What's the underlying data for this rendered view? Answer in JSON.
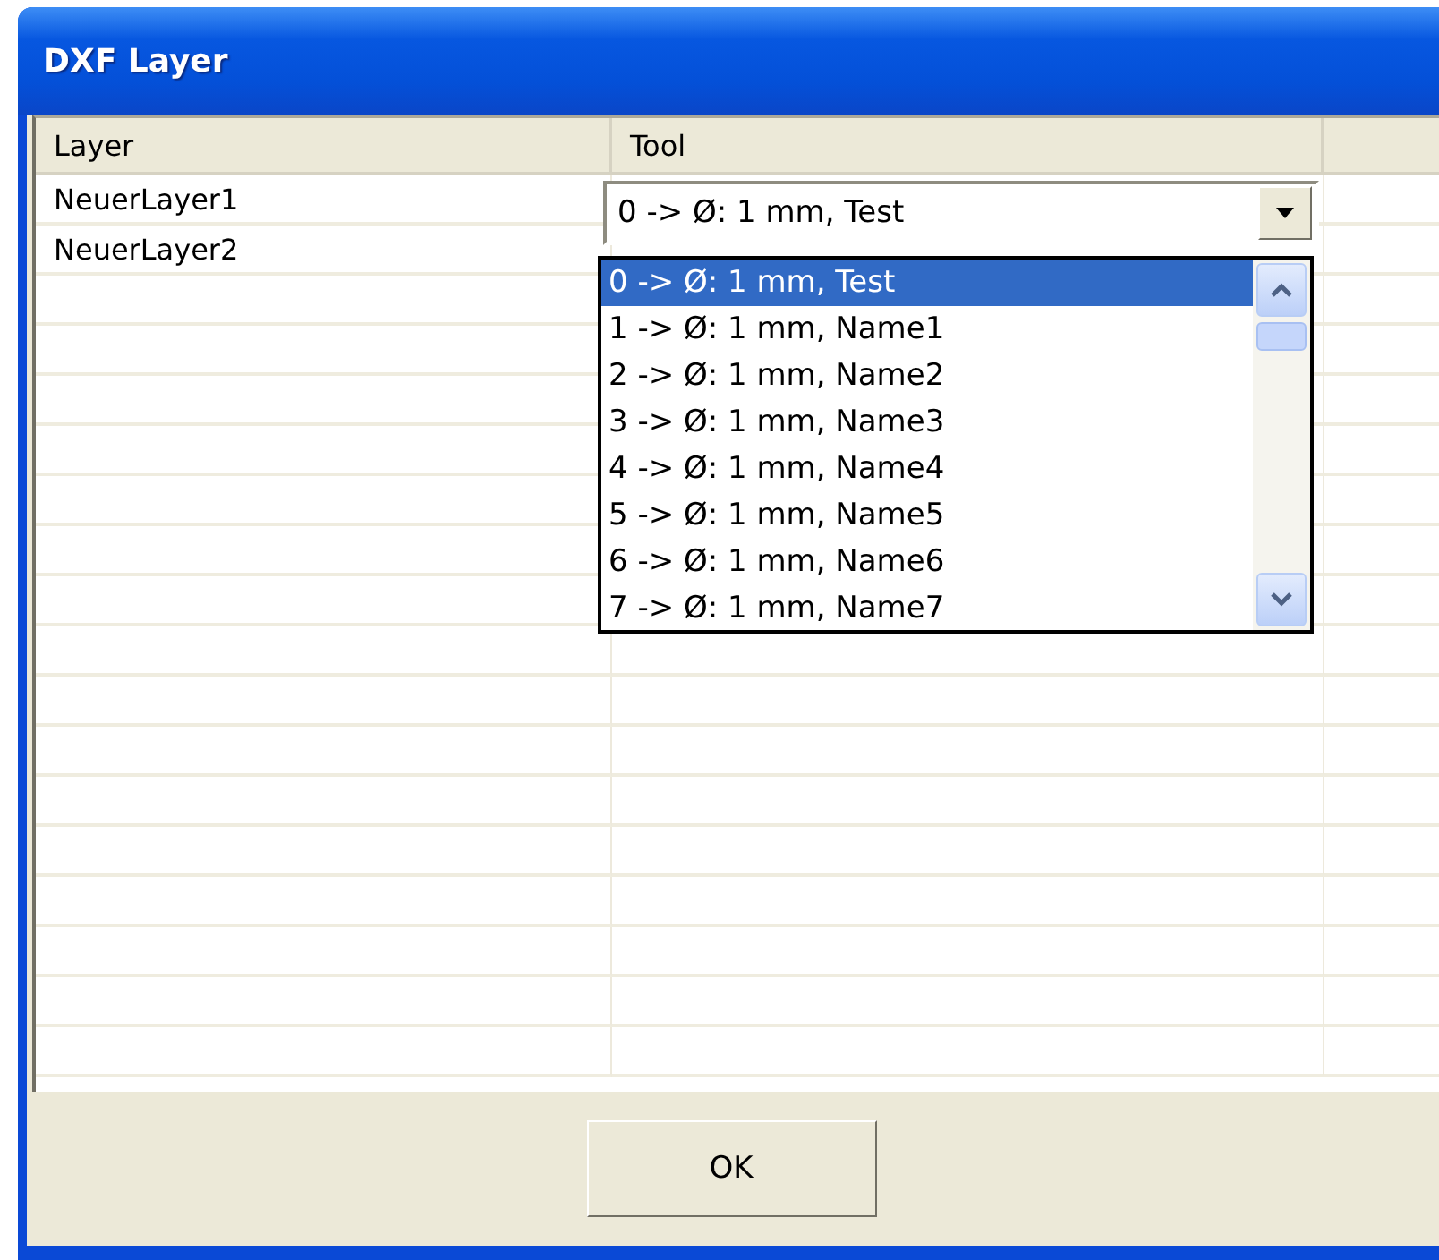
{
  "window": {
    "title": "DXF Layer"
  },
  "table": {
    "columns": [
      "Layer",
      "Tool"
    ],
    "rows": [
      {
        "layer": "NeuerLayer1",
        "tool": "0 -> Ø: 1 mm, Test"
      },
      {
        "layer": "NeuerLayer2"
      }
    ]
  },
  "dropdown": {
    "expanded": true,
    "items": [
      {
        "label": "0 -> Ø: 1 mm, Test",
        "selected": true
      },
      {
        "label": "1 -> Ø: 1 mm, Name1",
        "selected": false
      },
      {
        "label": "2 -> Ø: 1 mm, Name2",
        "selected": false
      },
      {
        "label": "3 -> Ø: 1 mm, Name3",
        "selected": false
      },
      {
        "label": "4 -> Ø: 1 mm, Name4",
        "selected": false
      },
      {
        "label": "5 -> Ø: 1 mm, Name5",
        "selected": false
      },
      {
        "label": "6 -> Ø: 1 mm, Name6",
        "selected": false
      },
      {
        "label": "7 -> Ø: 1 mm, Name7",
        "selected": false
      }
    ]
  },
  "buttons": [
    "OK"
  ]
}
